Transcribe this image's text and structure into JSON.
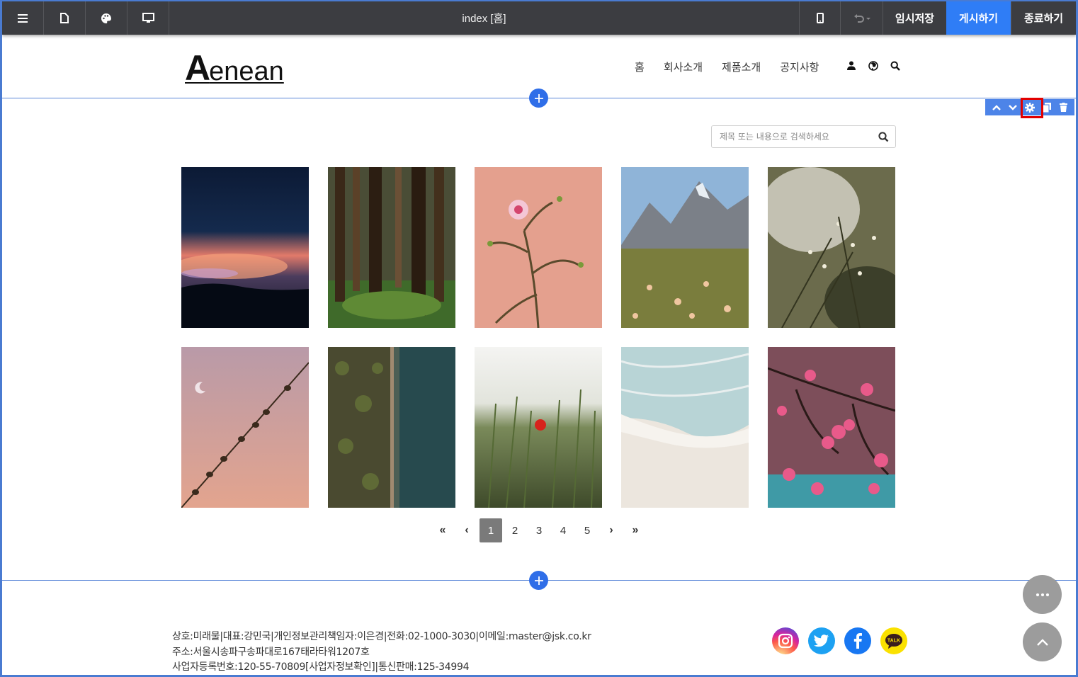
{
  "toolbar": {
    "title": "index [홈]",
    "temp_save": "임시저장",
    "publish": "게시하기",
    "exit": "종료하기",
    "icons": [
      "menu-icon",
      "page-icon",
      "palette-icon",
      "desktop-icon",
      "mobile-icon",
      "undo-icon"
    ]
  },
  "header": {
    "logo_first": "A",
    "logo_rest": "enean",
    "nav": [
      "홈",
      "회사소개",
      "제품소개",
      "공지사항"
    ],
    "nav_icons": [
      "user-icon",
      "globe-icon",
      "search-icon"
    ]
  },
  "section_tools": [
    "move-up-icon",
    "move-down-icon",
    "settings-icon",
    "copy-icon",
    "delete-icon"
  ],
  "search": {
    "placeholder": "제목 또는 내용으로 검색하세요"
  },
  "gallery": [
    {
      "subject": "night sky sunset clouds birds"
    },
    {
      "subject": "tall tree forest"
    },
    {
      "subject": "pink flower branch on pink wall"
    },
    {
      "subject": "mountain meadow flowers"
    },
    {
      "subject": "bokeh plant blossoms"
    },
    {
      "subject": "birds on wire pink sky moon"
    },
    {
      "subject": "aerial forest road river"
    },
    {
      "subject": "wheat field red poppy"
    },
    {
      "subject": "beach waves sand"
    },
    {
      "subject": "cherry blossom branch"
    }
  ],
  "pagination": {
    "first": "«",
    "prev": "‹",
    "pages": [
      "1",
      "2",
      "3",
      "4",
      "5"
    ],
    "current": "1",
    "next": "›",
    "last": "»"
  },
  "footer": {
    "line1": "상호:미래물|대표:강민국|개인정보관리책임자:이은경|전화:02-1000-3030|이메일:master@jsk.co.kr",
    "line2": "주소:서울시송파구송파대로167태라타워1207호",
    "line3": "사업자등록번호:120-55-70809[사업자정보확인]|통신판매:125-34994",
    "kakao_label": "TALK"
  },
  "colors": {
    "toolbar_bg": "#3c3d41",
    "publish_bg": "#2f7df6",
    "accent_blue": "#2f6ee8",
    "highlight_red": "#e20000"
  }
}
